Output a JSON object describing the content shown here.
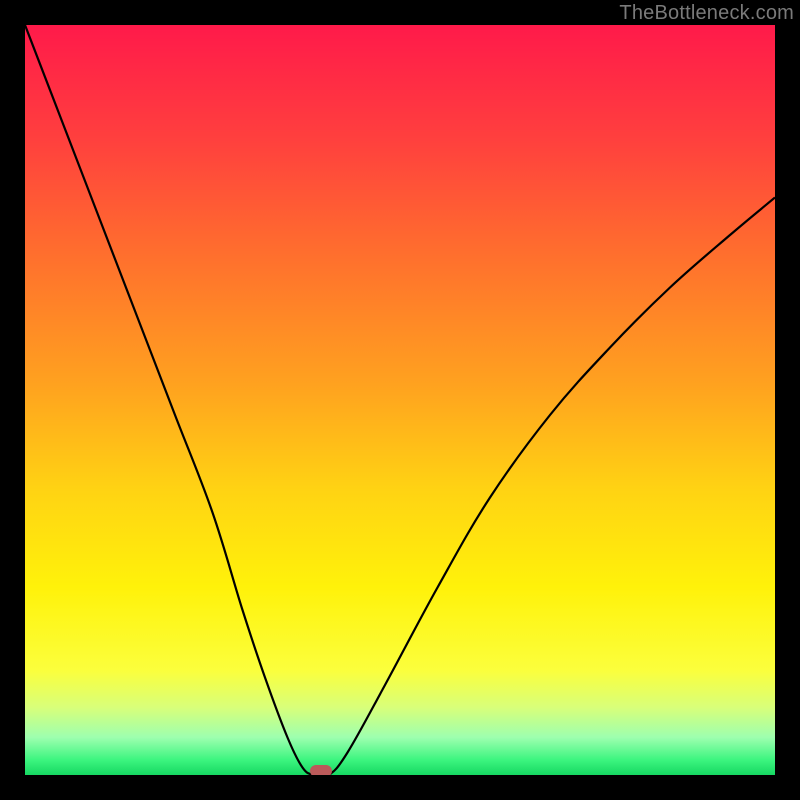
{
  "watermark": "TheBottleneck.com",
  "chart_data": {
    "type": "line",
    "title": "",
    "xlabel": "",
    "ylabel": "",
    "xlim": [
      0,
      100
    ],
    "ylim": [
      0,
      100
    ],
    "grid": false,
    "series": [
      {
        "name": "bottleneck-curve",
        "x": [
          0,
          5,
          10,
          15,
          20,
          25,
          29,
          32,
          35,
          37,
          38.5,
          40.5,
          43,
          48,
          55,
          62,
          70,
          78,
          86,
          94,
          100
        ],
        "y": [
          100,
          87,
          74,
          61,
          48,
          35,
          22,
          13,
          5,
          1,
          0,
          0,
          3,
          12,
          25,
          37,
          48,
          57,
          65,
          72,
          77
        ]
      }
    ],
    "marker": {
      "x": 39.5,
      "y": 0
    },
    "gradient_stops": [
      {
        "pos": 0,
        "color": "#ff1a4a"
      },
      {
        "pos": 15,
        "color": "#ff3f3e"
      },
      {
        "pos": 30,
        "color": "#ff6d2e"
      },
      {
        "pos": 48,
        "color": "#ffa21f"
      },
      {
        "pos": 62,
        "color": "#ffd313"
      },
      {
        "pos": 75,
        "color": "#fff20a"
      },
      {
        "pos": 86,
        "color": "#fbff3c"
      },
      {
        "pos": 91,
        "color": "#d8ff7a"
      },
      {
        "pos": 95,
        "color": "#9dffaf"
      },
      {
        "pos": 98,
        "color": "#3cf57f"
      },
      {
        "pos": 100,
        "color": "#16d862"
      }
    ]
  }
}
